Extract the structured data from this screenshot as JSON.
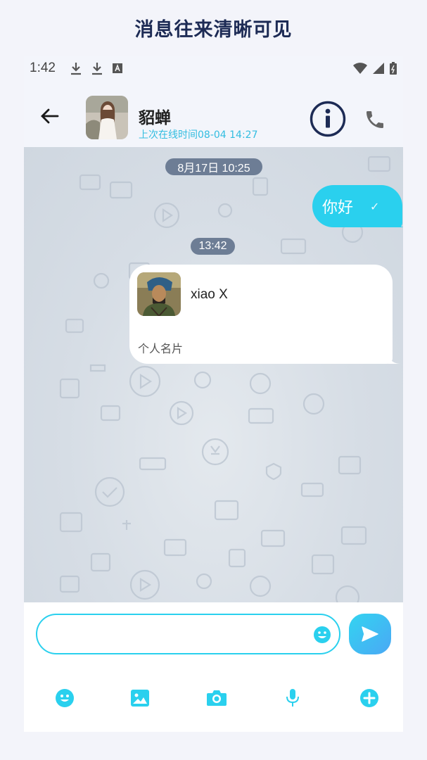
{
  "banner": {
    "title": "消息往来清晰可见"
  },
  "status_bar": {
    "time": "1:42"
  },
  "header": {
    "contact_name": "貂蝉",
    "last_seen": "上次在线时间08-04 14:27"
  },
  "chat": {
    "timestamp_1": "8月17日 10:25",
    "outgoing_message": {
      "text": "你好",
      "status": "✓"
    },
    "timestamp_2": "13:42",
    "contact_card": {
      "name": "xiao X",
      "type_label": "个人名片"
    }
  },
  "input": {
    "placeholder": "",
    "value": ""
  },
  "colors": {
    "accent": "#2ad0ee",
    "header_icon": "#1d2b55",
    "timestamp_bg": "#6d7d95"
  },
  "icons": {
    "back": "arrow-left-icon",
    "info": "info-circle-icon",
    "call": "phone-icon",
    "emoji": "smile-icon",
    "send": "send-icon",
    "toolbar": [
      "smile-icon",
      "image-icon",
      "camera-icon",
      "microphone-icon",
      "plus-circle-icon"
    ]
  }
}
